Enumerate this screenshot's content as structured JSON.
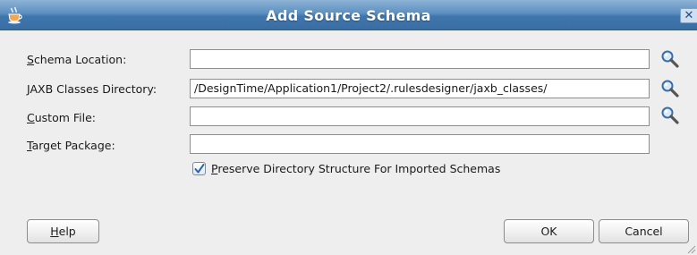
{
  "window": {
    "title": "Add Source Schema",
    "close_glyph": "✕"
  },
  "form": {
    "schema_location": {
      "label_first": "S",
      "label_rest": "chema Location:",
      "value": ""
    },
    "jaxb_dir": {
      "label_first": "J",
      "label_rest": "AXB Classes Directory:",
      "value": "/DesignTime/Application1/Project2/.rulesdesigner/jaxb_classes/"
    },
    "custom_file": {
      "label_first": "C",
      "label_rest": "ustom File:",
      "value": ""
    },
    "target_package": {
      "label_first": "T",
      "label_rest": "arget Package:",
      "value": ""
    },
    "preserve": {
      "label_first": "P",
      "label_rest": "reserve Directory Structure For Imported Schemas",
      "checked": true
    }
  },
  "buttons": {
    "help_first": "H",
    "help_rest": "elp",
    "ok": "OK",
    "cancel": "Cancel"
  },
  "icons": {
    "title": "java-cup-icon",
    "browse": "magnifier-icon"
  },
  "colors": {
    "titlebar": "#4a7fb5",
    "dialog_bg": "#eeeeee",
    "checkbox_check": "#2f63a8"
  }
}
